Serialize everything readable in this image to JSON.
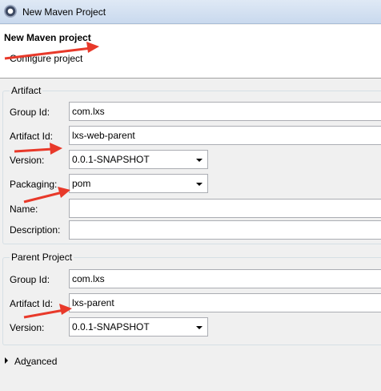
{
  "window": {
    "title": "New Maven Project",
    "icon": "eclipse-icon"
  },
  "header": {
    "title": "New Maven project",
    "subtitle": "Configure project"
  },
  "artifact": {
    "legend": "Artifact",
    "group_id": {
      "label": "Group Id:",
      "value": "com.lxs"
    },
    "artifact_id": {
      "label": "Artifact Id:",
      "value": "lxs-web-parent"
    },
    "version": {
      "label": "Version:",
      "value": "0.0.1-SNAPSHOT"
    },
    "packaging": {
      "label": "Packaging:",
      "value": "pom"
    },
    "name": {
      "label": "Name:",
      "value": ""
    },
    "description": {
      "label": "Description:",
      "value": ""
    }
  },
  "parent": {
    "legend": "Parent Project",
    "group_id": {
      "label": "Group Id:",
      "value": "com.lxs"
    },
    "artifact_id": {
      "label": "Artifact Id:",
      "value": "lxs-parent"
    },
    "version": {
      "label": "Version:",
      "value": "0.0.1-SNAPSHOT"
    }
  },
  "advanced": {
    "label_prefix": "Ad",
    "label_underlined": "v",
    "label_suffix": "anced"
  },
  "annotation_color": "#e8392a"
}
